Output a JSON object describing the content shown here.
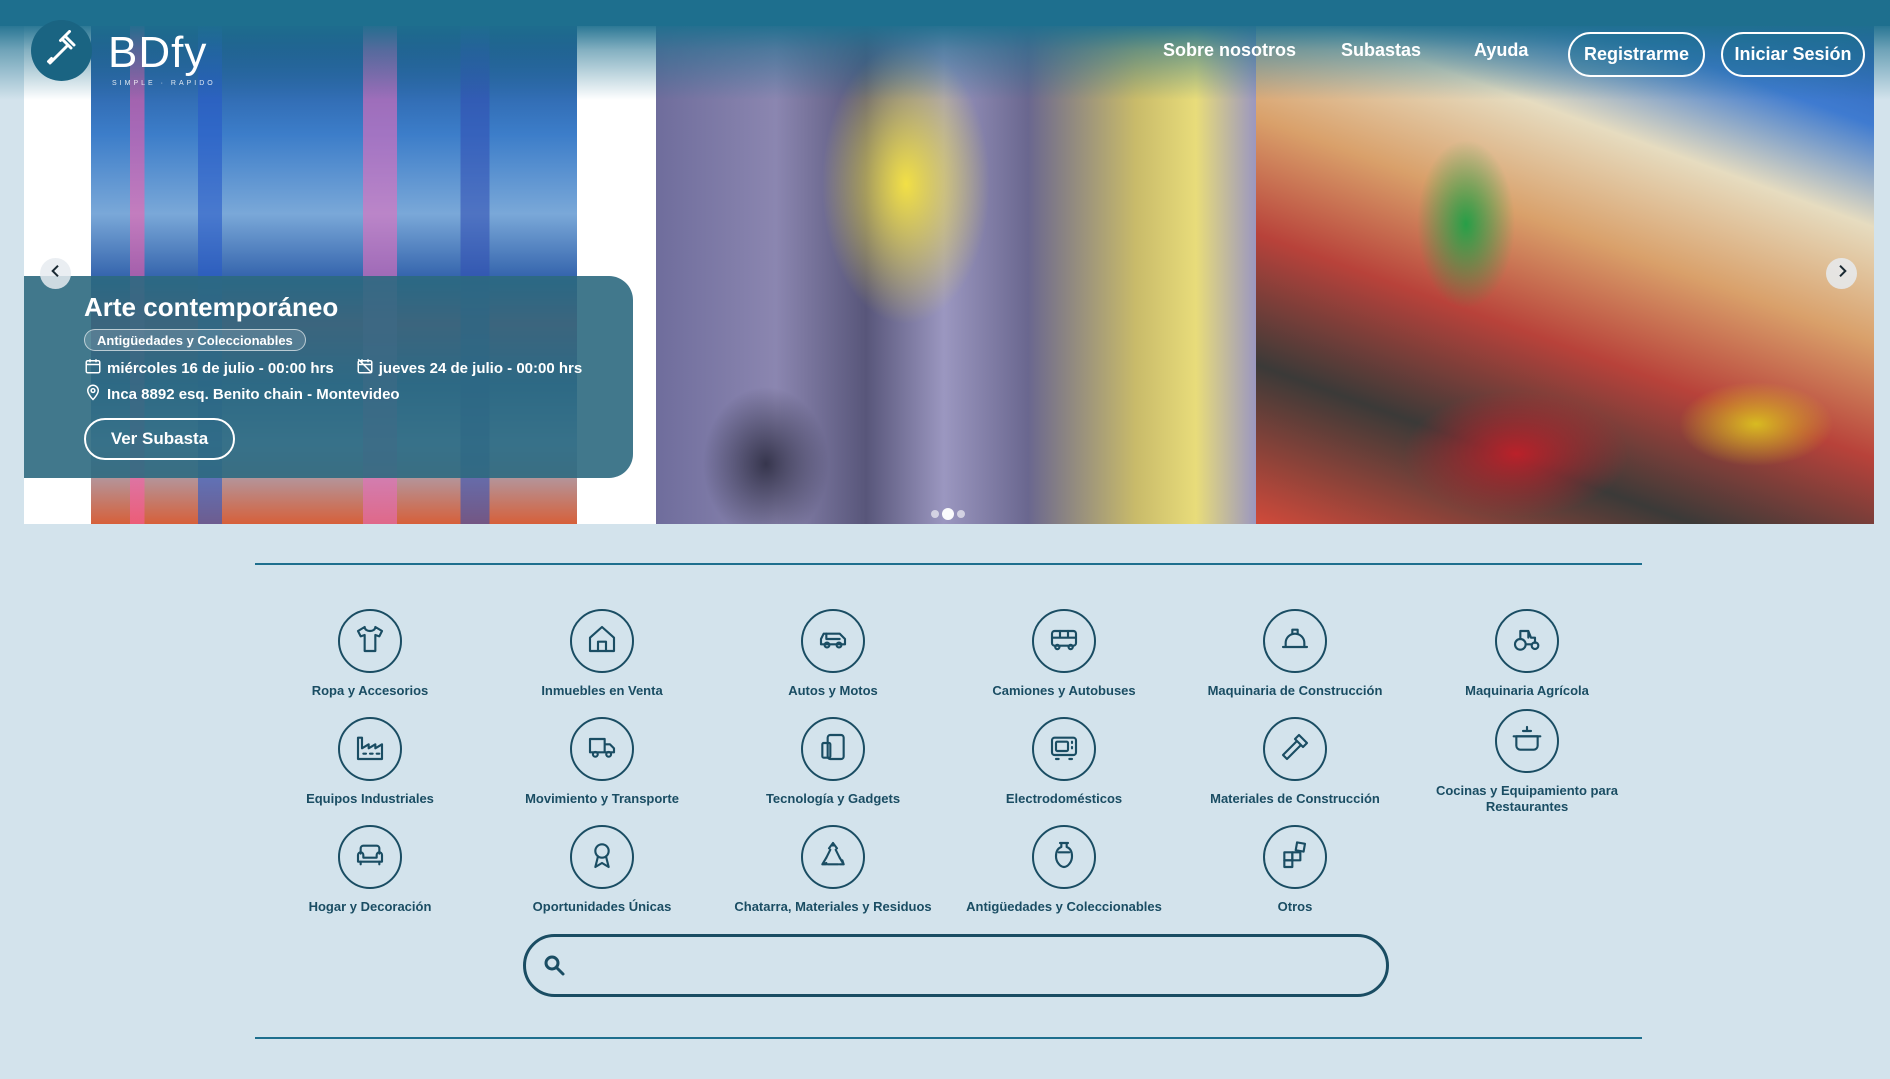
{
  "brand": {
    "name": "BDfy",
    "tagline": "SIMPLE · RAPIDO"
  },
  "nav": {
    "about": "Sobre nosotros",
    "auctions": "Subastas",
    "help": "Ayuda",
    "register": "Registrarme",
    "login": "Iniciar Sesión"
  },
  "hero": {
    "title": "Arte contemporáneo",
    "tag": "Antigüedades y Coleccionables",
    "start": "miércoles 16 de julio - 00:00 hrs",
    "end": "jueves 24 de julio - 00:00 hrs",
    "location": "Inca 8892 esq. Benito chain - Montevideo",
    "cta": "Ver Subasta",
    "active_slide": 2,
    "slide_count": 3
  },
  "categories": [
    {
      "label": "Ropa y Accesorios",
      "icon": "shirt-icon"
    },
    {
      "label": "Inmuebles en Venta",
      "icon": "house-icon"
    },
    {
      "label": "Autos y Motos",
      "icon": "car-icon"
    },
    {
      "label": "Camiones y Autobuses",
      "icon": "bus-icon"
    },
    {
      "label": "Maquinaria de Construcción",
      "icon": "hard-hat-icon"
    },
    {
      "label": "Maquinaria Agrícola",
      "icon": "tractor-icon"
    },
    {
      "label": "Equipos Industriales",
      "icon": "factory-icon"
    },
    {
      "label": "Movimiento y Transporte",
      "icon": "truck-icon"
    },
    {
      "label": "Tecnología y Gadgets",
      "icon": "devices-icon"
    },
    {
      "label": "Electrodomésticos",
      "icon": "microwave-icon"
    },
    {
      "label": "Materiales de Construcción",
      "icon": "hammer-icon"
    },
    {
      "label": "Cocinas y Equipamiento para Restaurantes",
      "icon": "cooking-pot-icon"
    },
    {
      "label": "Hogar y Decoración",
      "icon": "sofa-icon"
    },
    {
      "label": "Oportunidades Únicas",
      "icon": "award-icon"
    },
    {
      "label": "Chatarra, Materiales y Residuos",
      "icon": "recycle-icon"
    },
    {
      "label": "Antigüedades y Coleccionables",
      "icon": "vase-icon"
    },
    {
      "label": "Otros",
      "icon": "blocks-icon"
    }
  ],
  "search": {
    "placeholder": ""
  },
  "colors": {
    "primary": "#1e6f8e",
    "page_bg": "#d3e3ec",
    "ink": "#1a4d63"
  }
}
